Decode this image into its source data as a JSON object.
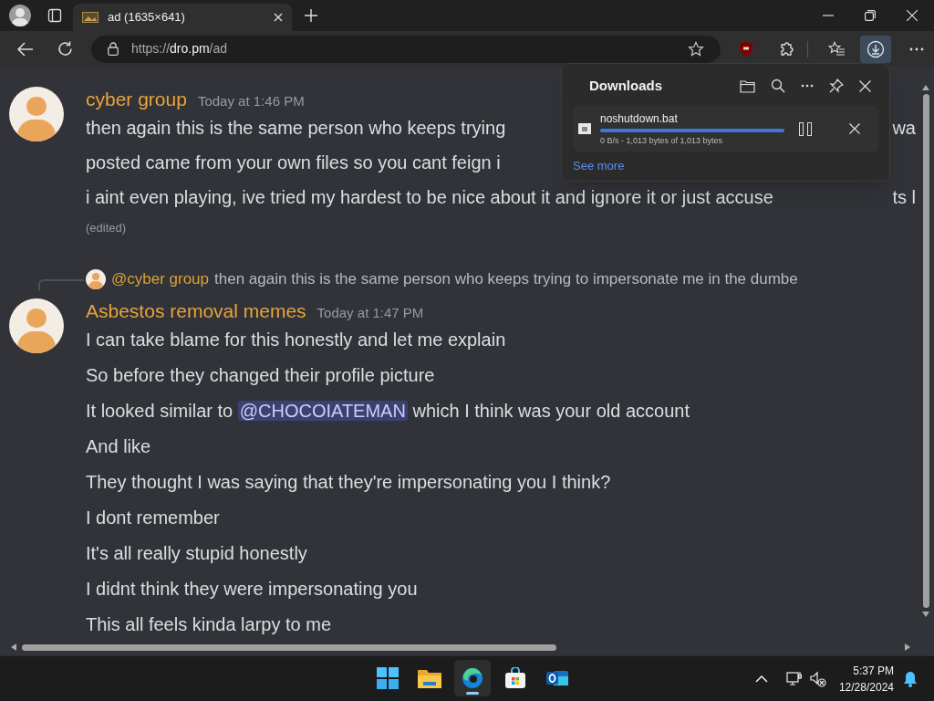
{
  "browser": {
    "tab": {
      "title": "ad (1635×641)",
      "selected": true
    },
    "address": {
      "scheme": "https://",
      "host": "dro.pm",
      "path": "/ad"
    }
  },
  "downloads_panel": {
    "title": "Downloads",
    "items": [
      {
        "name": "noshutdown.bat",
        "level": 1,
        "status": "0 B/s - 1,013 bytes of 1,013 bytes"
      }
    ],
    "see_more": "See more"
  },
  "messages": [
    {
      "author": "cyber group",
      "time": "Today at 1:46 PM",
      "lines": [
        [
          {
            "kind": "text",
            "text": "then again this is the same person who keeps trying"
          },
          {
            "kind": "tail",
            "text": "wa"
          }
        ],
        [
          {
            "kind": "text",
            "text": "posted came from your own files so you cant feign i"
          }
        ],
        [
          {
            "kind": "text",
            "text": "i aint even playing, ive tried my hardest to be nice about it and ignore it or just accuse"
          },
          {
            "kind": "tail",
            "text": "ts l"
          }
        ]
      ],
      "edited": "(edited)"
    },
    {
      "reply": {
        "mention": "@cyber group",
        "text": "then again this is the same person who keeps trying to impersonate me in the dumbe"
      },
      "author": "Asbestos removal memes",
      "time": "Today at 1:47 PM",
      "lines": [
        [
          {
            "kind": "text",
            "text": "I can take blame for this honestly and let me explain"
          }
        ],
        [
          {
            "kind": "text",
            "text": "So before they changed their profile picture"
          }
        ],
        [
          {
            "kind": "text",
            "text": "It looked similar to "
          },
          {
            "kind": "mention",
            "text": "@CHOCOIATEMAN"
          },
          {
            "kind": "text",
            "text": " which I think was your old account"
          }
        ],
        [
          {
            "kind": "text",
            "text": "And like"
          }
        ],
        [
          {
            "kind": "text",
            "text": "They thought I was saying that they're impersonating you I think?"
          }
        ],
        [
          {
            "kind": "text",
            "text": "I dont remember"
          }
        ],
        [
          {
            "kind": "text",
            "text": "It's all really stupid honestly"
          }
        ],
        [
          {
            "kind": "text",
            "text": "I didnt think they were impersonating you"
          }
        ],
        [
          {
            "kind": "text",
            "text": "This all feels kinda larpy to me"
          }
        ]
      ]
    }
  ],
  "taskbar": {
    "time": "5:37 PM",
    "date": "12/28/2024"
  }
}
